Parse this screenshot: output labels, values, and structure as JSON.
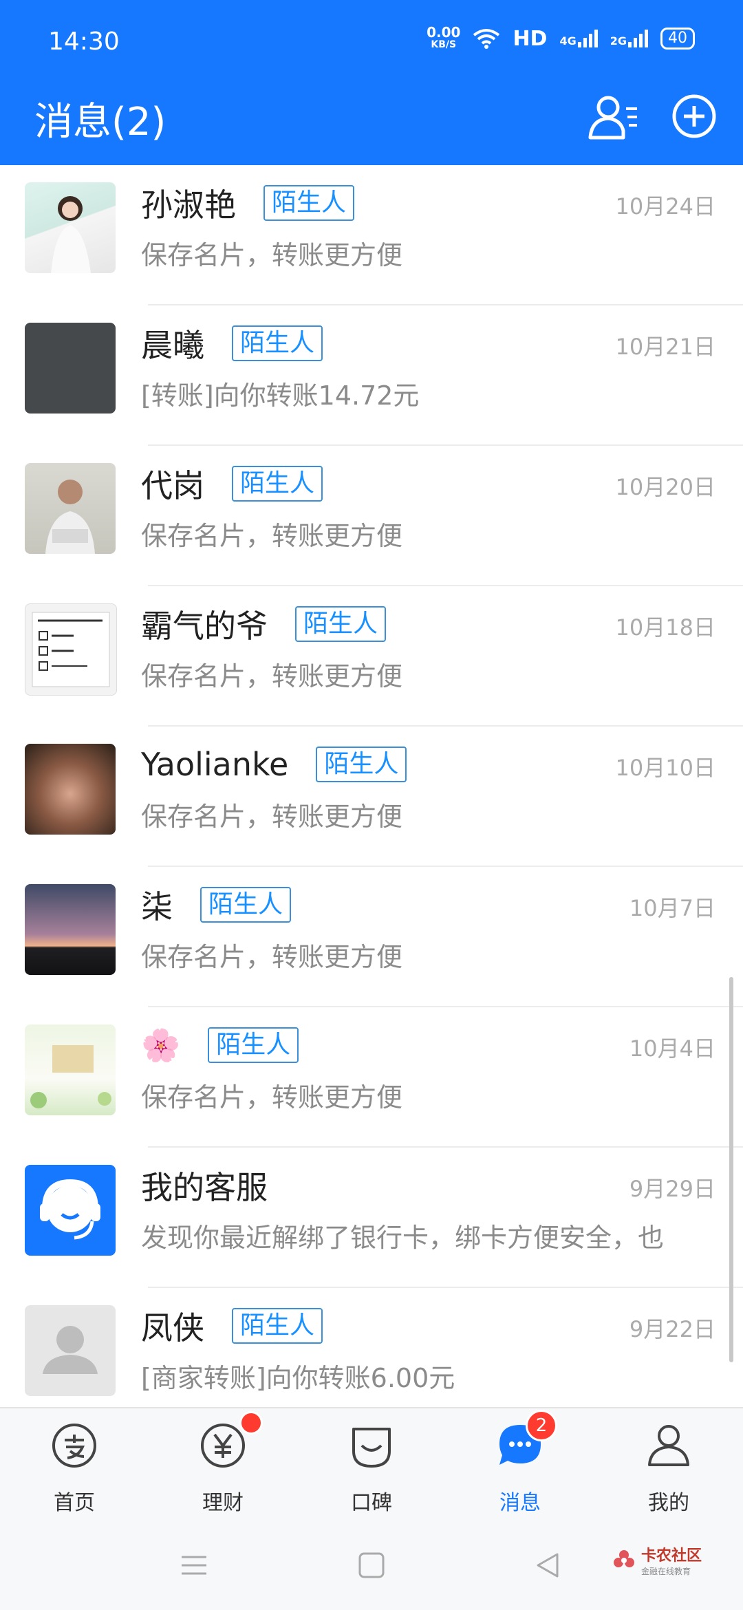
{
  "status_bar": {
    "time": "14:30",
    "speed_value": "0.00",
    "speed_unit": "KB/S",
    "hd": "HD",
    "net1": "4G",
    "net2": "2G",
    "battery": "40"
  },
  "header": {
    "title": "消息(2)",
    "bg_color": "#1677ff"
  },
  "messages": [
    {
      "name": "孙淑艳",
      "tag": "陌生人",
      "date": "10月24日",
      "preview": "保存名片，转账更方便"
    },
    {
      "name": "晨曦",
      "tag": "陌生人",
      "date": "10月21日",
      "preview": "[转账]向你转账14.72元"
    },
    {
      "name": "代岗",
      "tag": "陌生人",
      "date": "10月20日",
      "preview": "保存名片，转账更方便"
    },
    {
      "name": "霸气的爷",
      "tag": "陌生人",
      "date": "10月18日",
      "preview": "保存名片，转账更方便"
    },
    {
      "name": "Yaolianke",
      "tag": "陌生人",
      "date": "10月10日",
      "preview": "保存名片，转账更方便"
    },
    {
      "name": "柒",
      "tag": "陌生人",
      "date": "10月7日",
      "preview": "保存名片，转账更方便"
    },
    {
      "name": "🌸",
      "tag": "陌生人",
      "date": "10月4日",
      "preview": "保存名片，转账更方便"
    },
    {
      "name": "我的客服",
      "tag": "",
      "date": "9月29日",
      "preview": "发现你最近解绑了银行卡，绑卡方便安全，也"
    },
    {
      "name": "凤侠",
      "tag": "陌生人",
      "date": "9月22日",
      "preview": "[商家转账]向你转账6.00元"
    }
  ],
  "tabs": [
    {
      "label": "首页",
      "icon": "alipay-home-icon"
    },
    {
      "label": "理财",
      "icon": "yen-icon"
    },
    {
      "label": "口碑",
      "icon": "koubei-smile-icon"
    },
    {
      "label": "消息",
      "icon": "chat-bubble-icon",
      "badge": "2"
    },
    {
      "label": "我的",
      "icon": "person-icon"
    }
  ],
  "watermark": {
    "name": "卡农社区",
    "sub": "金融在线教育"
  }
}
